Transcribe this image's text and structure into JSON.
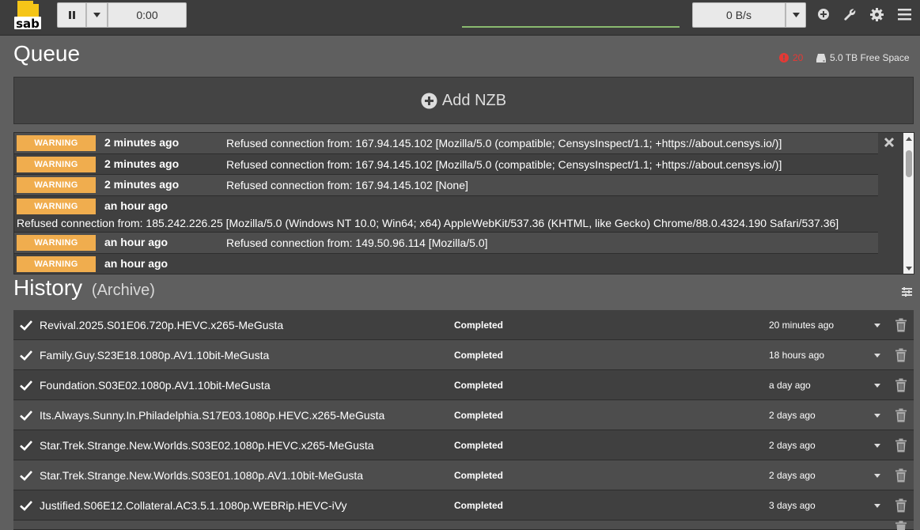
{
  "app": {
    "logo_text": "sab"
  },
  "toolbar": {
    "pause_icon": "pause-icon",
    "timer": "0:00",
    "speed": "0 B/s",
    "icons": [
      "plus-circle-icon",
      "wrench-icon",
      "gear-icon",
      "hamburger-menu-icon"
    ]
  },
  "queue": {
    "title": "Queue",
    "warning_count": "20",
    "free_space": "5.0 TB Free Space",
    "add_nzb_label": "Add NZB"
  },
  "warnings": [
    {
      "badge": "WARNING",
      "time": "2 minutes ago",
      "message": "Refused connection from: 167.94.145.102 [Mozilla/5.0 (compatible; CensysInspect/1.1; +https://about.censys.io/)]"
    },
    {
      "badge": "WARNING",
      "time": "2 minutes ago",
      "message": "Refused connection from: 167.94.145.102 [Mozilla/5.0 (compatible; CensysInspect/1.1; +https://about.censys.io/)]"
    },
    {
      "badge": "WARNING",
      "time": "2 minutes ago",
      "message": "Refused connection from: 167.94.145.102 [None]"
    },
    {
      "badge": "WARNING",
      "time": "an hour ago",
      "message": "Refused connection from: 185.242.226.25 [Mozilla/5.0 (Windows NT 10.0; Win64; x64) AppleWebKit/537.36 (KHTML, like Gecko) Chrome/88.0.4324.190 Safari/537.36]"
    },
    {
      "badge": "WARNING",
      "time": "an hour ago",
      "message": "Refused connection from: 149.50.96.114 [Mozilla/5.0]"
    },
    {
      "badge": "WARNING",
      "time": "an hour ago",
      "message": ""
    }
  ],
  "history": {
    "title": "History",
    "subtitle": "(Archive)",
    "rows": [
      {
        "name": "Revival.2025.S01E06.720p.HEVC.x265-MeGusta",
        "status": "Completed",
        "time": "20 minutes ago"
      },
      {
        "name": "Family.Guy.S23E18.1080p.AV1.10bit-MeGusta",
        "status": "Completed",
        "time": "18 hours ago"
      },
      {
        "name": "Foundation.S03E02.1080p.AV1.10bit-MeGusta",
        "status": "Completed",
        "time": "a day ago"
      },
      {
        "name": "Its.Always.Sunny.In.Philadelphia.S17E03.1080p.HEVC.x265-MeGusta",
        "status": "Completed",
        "time": "2 days ago"
      },
      {
        "name": "Star.Trek.Strange.New.Worlds.S03E02.1080p.HEVC.x265-MeGusta",
        "status": "Completed",
        "time": "2 days ago"
      },
      {
        "name": "Star.Trek.Strange.New.Worlds.S03E01.1080p.AV1.10bit-MeGusta",
        "status": "Completed",
        "time": "2 days ago"
      },
      {
        "name": "Justified.S06E12.Collateral.AC3.5.1.1080p.WEBRip.HEVC-iVy",
        "status": "Completed",
        "time": "3 days ago"
      },
      {
        "name": "",
        "status": "",
        "time": ""
      }
    ]
  },
  "colors": {
    "warning_badge": "#f0ad4e",
    "error_red": "#e53935",
    "speed_bar": "#8aba6f",
    "logo_yellow": "#f5c518"
  }
}
